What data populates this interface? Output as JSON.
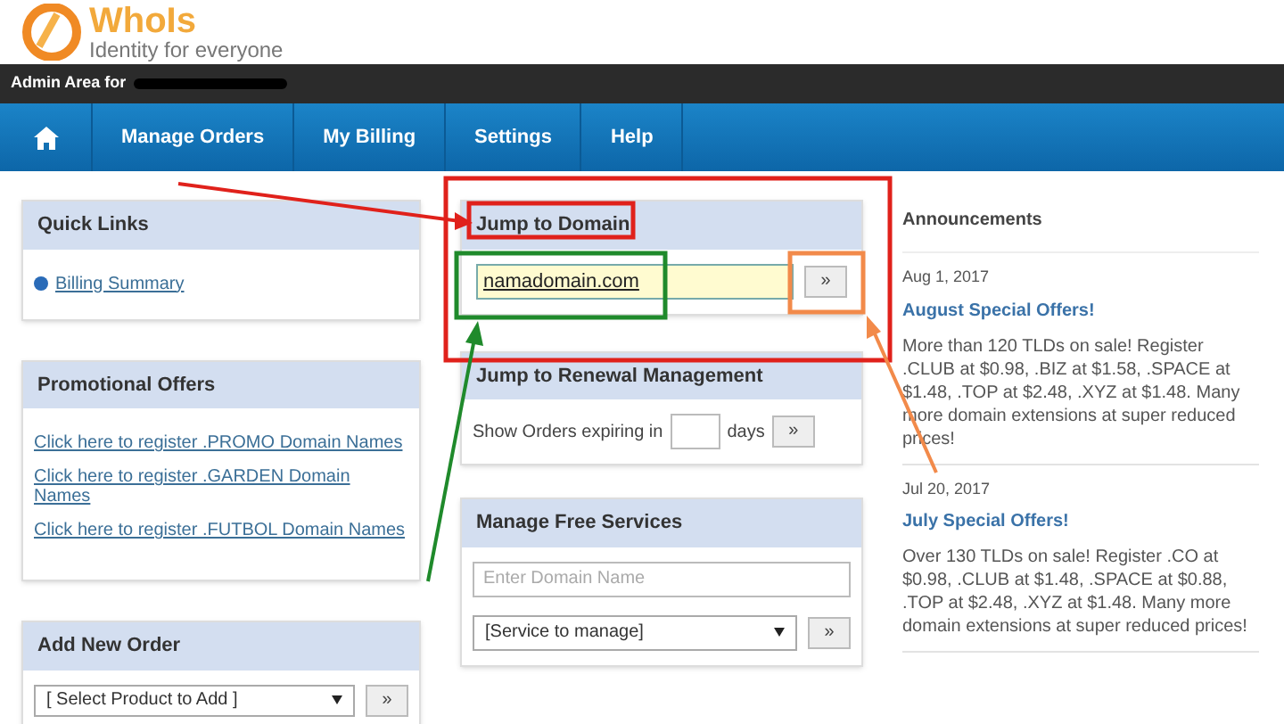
{
  "logo": {
    "name": "WhoIs",
    "tagline": "Identity for everyone"
  },
  "admin_bar": {
    "label": "Admin Area for",
    "redacted": true
  },
  "nav": [
    {
      "kind": "home"
    },
    {
      "kind": "text",
      "label": "Manage Orders"
    },
    {
      "kind": "text",
      "label": "My Billing"
    },
    {
      "kind": "text",
      "label": "Settings"
    },
    {
      "kind": "text",
      "label": "Help"
    }
  ],
  "quick_links": {
    "title": "Quick Links",
    "links": [
      "Billing Summary"
    ]
  },
  "promotional_offers": {
    "title": "Promotional Offers",
    "links": [
      "Click here to register .PROMO Domain Names",
      "Click here to register .GARDEN Domain Names",
      "Click here to register .FUTBOL Domain Names"
    ]
  },
  "add_new_order": {
    "title": "Add New Order",
    "select": "[ Select Product to Add ]",
    "button": "»"
  },
  "jump_to_domain": {
    "title": "Jump to Domain",
    "value": "namadomain.com",
    "button": "»"
  },
  "renewal": {
    "title": "Jump to Renewal Management",
    "before": "Show Orders expiring in",
    "after": "days",
    "button": "»"
  },
  "free_services": {
    "title": "Manage Free Services",
    "placeholder": "Enter Domain Name",
    "select": "[Service to manage]",
    "button": "»"
  },
  "announcements": {
    "title": "Announcements",
    "items": [
      {
        "date": "Aug 1, 2017",
        "title": "August Special Offers!",
        "body": "More than 120 TLDs on sale! Register .CLUB at $0.98, .BIZ at $1.58, .SPACE at $1.48, .TOP at $2.48, .XYZ at $1.48. Many more domain extensions at super reduced prices!"
      },
      {
        "date": "Jul 20, 2017",
        "title": "July Special Offers!",
        "body": "Over 130 TLDs on sale! Register .CO at $0.98, .CLUB at $1.48, .SPACE at $0.88, .TOP at $2.48, .XYZ at $1.48. Many more domain extensions at super reduced prices!"
      }
    ]
  }
}
